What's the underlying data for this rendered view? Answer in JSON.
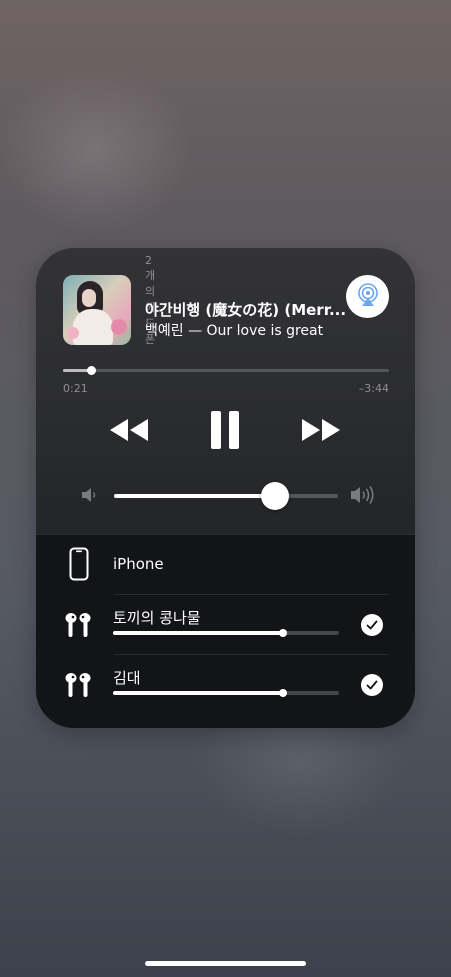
{
  "now_playing": {
    "device_caption": "2개의 헤드폰",
    "title": "야간비행 (魔女の花) (Merr...",
    "subtitle": "백예린 — Our love is great",
    "airplay_icon": "airplay-audio-icon",
    "progress": 0.085,
    "elapsed": "0:21",
    "remaining": "–3:44"
  },
  "controls": {
    "rewind_icon": "backward-icon",
    "pause_icon": "pause-icon",
    "forward_icon": "forward-icon"
  },
  "volume": {
    "level": 0.72,
    "low_icon": "speaker-low-icon",
    "high_icon": "speaker-high-icon"
  },
  "devices": [
    {
      "name": "iPhone",
      "icon": "iphone-icon",
      "selected": false
    },
    {
      "name": "토끼의 콩나물",
      "icon": "airpods-icon",
      "selected": true,
      "volume": 0.75
    },
    {
      "name": "김대",
      "icon": "airpods-icon",
      "selected": true,
      "volume": 0.75
    }
  ],
  "colors": {
    "panel": "#2c2d31",
    "device_section": "#131417",
    "track": "#56575b",
    "accent_white": "#ffffff",
    "secondary_text": "#8e8e93",
    "airplay_blue": "#6ca4f0"
  }
}
